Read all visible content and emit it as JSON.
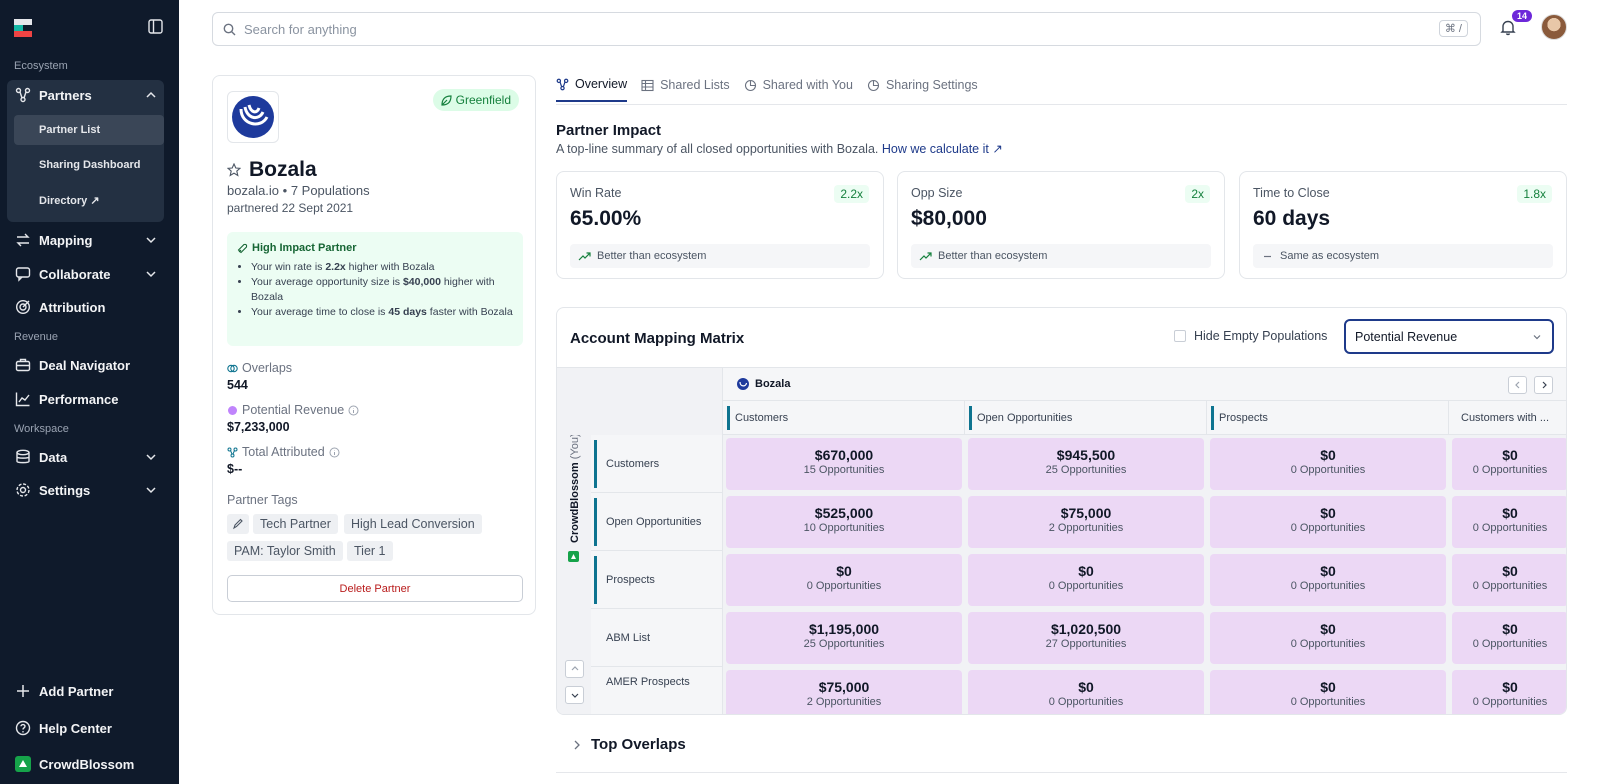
{
  "sidebar": {
    "sections": {
      "ecosystem": "Ecosystem",
      "revenue": "Revenue",
      "workspace": "Workspace"
    },
    "partners": {
      "label": "Partners",
      "subitems": [
        "Partner List",
        "Sharing Dashboard",
        "Directory ↗"
      ]
    },
    "mapping": "Mapping",
    "collaborate": "Collaborate",
    "attribution": "Attribution",
    "deal_navigator": "Deal Navigator",
    "performance": "Performance",
    "data": "Data",
    "settings": "Settings",
    "add_partner": "Add Partner",
    "help_center": "Help Center",
    "org_name": "CrowdBlossom"
  },
  "topbar": {
    "search_placeholder": "Search for anything",
    "shortcut": "⌘ /",
    "notification_count": "14"
  },
  "partner": {
    "tag": "Greenfield",
    "name": "Bozala",
    "domain_line": "bozala.io • 7 Populations",
    "partnered": "partnered 22 Sept 2021",
    "impact": {
      "title": "High Impact Partner",
      "b1_pre": "Your win rate is ",
      "b1_bold": "2.2x",
      "b1_post": " higher with Bozala",
      "b2_pre": "Your average opportunity size is ",
      "b2_bold": "$40,000",
      "b2_post": " higher with Bozala",
      "b3_pre": "Your average time to close is ",
      "b3_bold": "45 days",
      "b3_post": " faster with Bozala"
    },
    "overlaps_label": "Overlaps",
    "overlaps_value": "544",
    "potential_label": "Potential Revenue",
    "potential_value": "$7,233,000",
    "attributed_label": "Total Attributed",
    "attributed_value": "$--",
    "tags_title": "Partner Tags",
    "tags": [
      "Tech Partner",
      "High Lead Conversion",
      "PAM: Taylor Smith",
      "Tier 1"
    ],
    "delete_label": "Delete Partner"
  },
  "tabs": [
    "Overview",
    "Shared Lists",
    "Shared with You",
    "Sharing Settings"
  ],
  "impact_section": {
    "title": "Partner Impact",
    "subtitle": "A top-line summary of all closed opportunities with Bozala. ",
    "link": "How we calculate it ↗"
  },
  "metrics": [
    {
      "label": "Win Rate",
      "value": "65.00%",
      "mult": "2.2x",
      "foot": "Better than ecosystem"
    },
    {
      "label": "Opp Size",
      "value": "$80,000",
      "mult": "2x",
      "foot": "Better than ecosystem"
    },
    {
      "label": "Time to Close",
      "value": "60 days",
      "mult": "1.8x",
      "foot": "Same as ecosystem"
    }
  ],
  "matrix": {
    "title": "Account Mapping Matrix",
    "hide_empty": "Hide Empty Populations",
    "select_value": "Potential Revenue",
    "partner_name": "Bozala",
    "you_label": "CrowdBlossom",
    "you_suffix": "(You)",
    "columns": [
      "Customers",
      "Open Opportunities",
      "Prospects",
      "Customers with ..."
    ],
    "rows": [
      {
        "label": "Customers",
        "cells": [
          [
            "$670,000",
            "15 Opportunities"
          ],
          [
            "$945,500",
            "25 Opportunities"
          ],
          [
            "$0",
            "0 Opportunities"
          ],
          [
            "$0",
            "0 Opportunities"
          ]
        ]
      },
      {
        "label": "Open Opportunities",
        "cells": [
          [
            "$525,000",
            "10 Opportunities"
          ],
          [
            "$75,000",
            "2 Opportunities"
          ],
          [
            "$0",
            "0 Opportunities"
          ],
          [
            "$0",
            "0 Opportunities"
          ]
        ]
      },
      {
        "label": "Prospects",
        "cells": [
          [
            "$0",
            "0 Opportunities"
          ],
          [
            "$0",
            "0 Opportunities"
          ],
          [
            "$0",
            "0 Opportunities"
          ],
          [
            "$0",
            "0 Opportunities"
          ]
        ]
      },
      {
        "label": "ABM List",
        "cells": [
          [
            "$1,195,000",
            "25 Opportunities"
          ],
          [
            "$1,020,500",
            "27 Opportunities"
          ],
          [
            "$0",
            "0 Opportunities"
          ],
          [
            "$0",
            "0 Opportunities"
          ]
        ]
      },
      {
        "label": "AMER Prospects",
        "cells": [
          [
            "$75,000",
            "2 Opportunities"
          ],
          [
            "$0",
            "0 Opportunities"
          ],
          [
            "$0",
            "0 Opportunities"
          ],
          [
            "$0",
            "0 Opportunities"
          ]
        ]
      }
    ]
  },
  "top_overlaps": "Top Overlaps"
}
